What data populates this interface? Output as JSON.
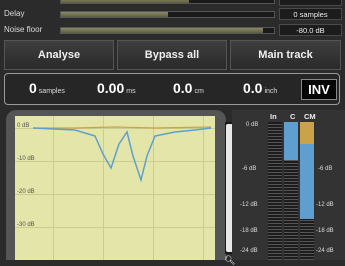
{
  "rows": [
    {
      "label": "Delay",
      "value": "0 samples",
      "fill": 0.5
    },
    {
      "label": "Noise floor",
      "value": "-80.0 dB",
      "fill": 0.95
    }
  ],
  "buttons": {
    "analyse": "Analyse",
    "bypass_all": "Bypass all",
    "main_track": "Main track"
  },
  "display": {
    "samples": {
      "value": "0",
      "unit": "samples"
    },
    "ms": {
      "value": "0.00",
      "unit": "ms"
    },
    "cm": {
      "value": "0.0",
      "unit": "cm"
    },
    "inch": {
      "value": "0.0",
      "unit": "inch"
    },
    "inv": "INV"
  },
  "plot": {
    "ticks": [
      "0 dB",
      "-10 dB",
      "-20 dB",
      "-30 dB"
    ],
    "zoom_icon": "magnifier-icon"
  },
  "meters": {
    "headers": [
      "In",
      "C",
      "CM"
    ],
    "scale": [
      "0 dB",
      "-6 dB",
      "-12 dB",
      "-18 dB",
      "-24 dB"
    ],
    "scale_right": [
      "-6 dB",
      "-12 dB",
      "-18 dB",
      "-24 dB"
    ],
    "colors": {
      "c": "#5f9fd0",
      "cm": "#c9a24a",
      "in": "#1d1d1d"
    }
  }
}
